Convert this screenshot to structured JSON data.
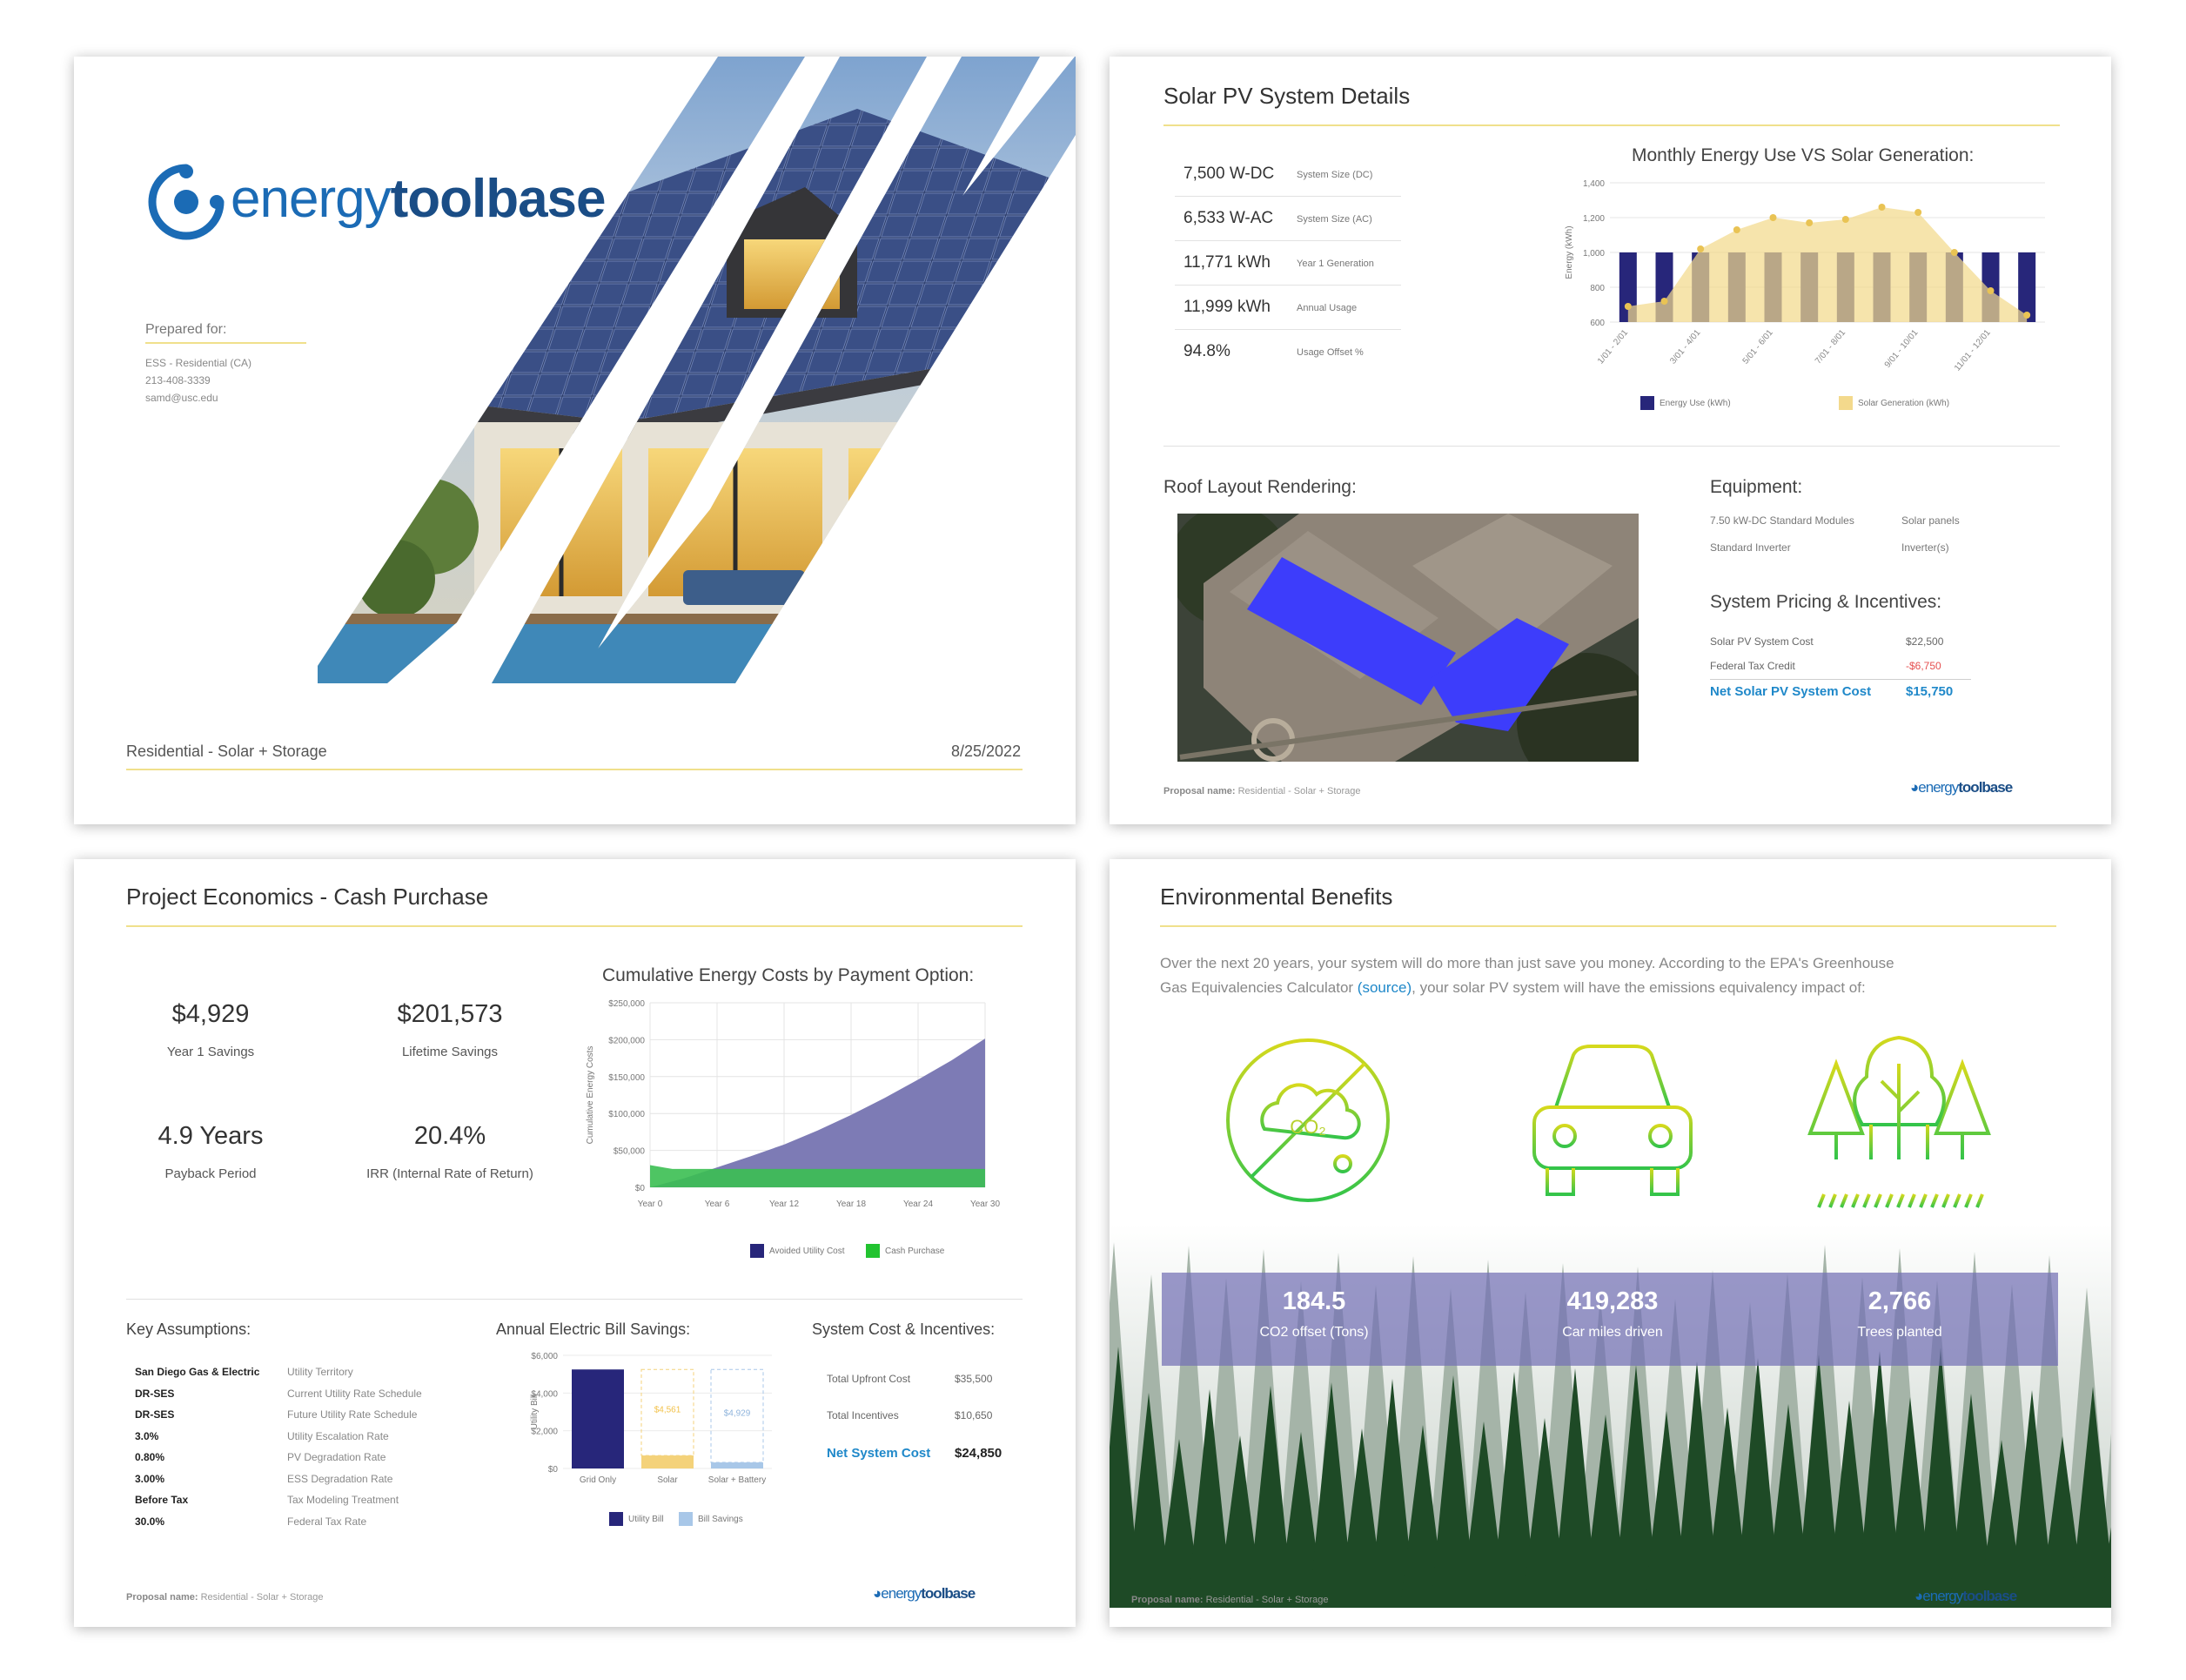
{
  "brand": {
    "name_part1": "energy",
    "name_part2": "toolbase",
    "colors": {
      "primary": "#1b6bb5",
      "accent_gold": "#f0e08c",
      "link_blue": "#1f88c9"
    }
  },
  "cover": {
    "prepared_for_label": "Prepared for:",
    "client_lines": [
      "ESS - Residential (CA)",
      "213-408-3339",
      "samd@usc.edu"
    ],
    "footer_left": "Residential - Solar + Storage",
    "footer_right": "8/25/2022"
  },
  "solar_details": {
    "title": "Solar PV System Details",
    "specs": [
      {
        "value": "7,500 W-DC",
        "label": "System Size (DC)"
      },
      {
        "value": "6,533 W-AC",
        "label": "System Size (AC)"
      },
      {
        "value": "11,771 kWh",
        "label": "Year 1 Generation"
      },
      {
        "value": "11,999 kWh",
        "label": "Annual Usage"
      },
      {
        "value": "94.8%",
        "label": "Usage Offset %"
      }
    ],
    "roof_title": "Roof Layout Rendering:",
    "equipment_title": "Equipment:",
    "equipment": [
      {
        "name": "7.50 kW-DC Standard Modules",
        "type": "Solar panels"
      },
      {
        "name": "Standard Inverter",
        "type": "Inverter(s)"
      }
    ],
    "pricing_title": "System Pricing & Incentives:",
    "pricing": [
      {
        "label": "Solar PV System Cost",
        "value": "$22,500"
      },
      {
        "label": "Federal Tax Credit",
        "value": "-$6,750"
      }
    ],
    "net_label": "Net Solar PV System Cost",
    "net_value": "$15,750",
    "footer_label": "Proposal name:",
    "footer_value": "Residential - Solar + Storage"
  },
  "economics": {
    "title": "Project Economics - Cash Purchase",
    "stats": [
      {
        "value": "$4,929",
        "label": "Year 1 Savings"
      },
      {
        "value": "$201,573",
        "label": "Lifetime Savings"
      },
      {
        "value": "4.9 Years",
        "label": "Payback Period"
      },
      {
        "value": "20.4%",
        "label": "IRR (Internal Rate of Return)"
      }
    ],
    "assumptions_title": "Key Assumptions:",
    "assumptions": [
      {
        "value": "San Diego Gas & Electric",
        "label": "Utility Territory"
      },
      {
        "value": "DR-SES",
        "label": "Current Utility Rate Schedule"
      },
      {
        "value": "DR-SES",
        "label": "Future Utility Rate Schedule"
      },
      {
        "value": "3.0%",
        "label": "Utility Escalation Rate"
      },
      {
        "value": "0.80%",
        "label": "PV Degradation Rate"
      },
      {
        "value": "3.00%",
        "label": "ESS Degradation Rate"
      },
      {
        "value": "Before Tax",
        "label": "Tax Modeling Treatment"
      },
      {
        "value": "30.0%",
        "label": "Federal Tax Rate"
      }
    ],
    "cost_title": "System Cost & Incentives:",
    "costs": [
      {
        "label": "Total Upfront Cost",
        "value": "$35,500"
      },
      {
        "label": "Total Incentives",
        "value": "$10,650"
      }
    ],
    "net_label": "Net System Cost",
    "net_value": "$24,850",
    "footer_label": "Proposal name:",
    "footer_value": "Residential - Solar + Storage"
  },
  "environment": {
    "title": "Environmental Benefits",
    "intro_1": "Over the next 20 years, your system will do more than just save you money.  According to the EPA's Greenhouse",
    "intro_2a": "Gas Equivalencies Calculator ",
    "intro_link": "(source)",
    "intro_2b": ", your solar PV system will have the emissions equivalency impact of:",
    "co2_glyph": "CO₂",
    "metrics": [
      {
        "value": "184.5",
        "label": "CO2 offset (Tons)"
      },
      {
        "value": "419,283",
        "label": "Car miles driven"
      },
      {
        "value": "2,766",
        "label": "Trees planted"
      }
    ],
    "icons": [
      "co2-cloud-icon",
      "car-icon",
      "trees-icon"
    ],
    "footer_label": "Proposal name:",
    "footer_value": "Residential - Solar + Storage"
  },
  "chart_data": [
    {
      "type": "bar",
      "title": "Monthly Energy Use VS Solar Generation:",
      "ylabel": "Energy (kWh)",
      "ylim": [
        600,
        1400
      ],
      "yticks": [
        "600",
        "800",
        "1,000",
        "1,200",
        "1,400"
      ],
      "categories": [
        "1/01 - 2/01",
        "2/01 - 3/01",
        "3/01 - 4/01",
        "4/01 - 5/01",
        "5/01 - 6/01",
        "6/01 - 7/01",
        "7/01 - 8/01",
        "8/01 - 9/01",
        "9/01 - 10/01",
        "10/01 - 11/01",
        "11/01 - 12/01",
        "12/01 - 1/01"
      ],
      "xtick_labels": [
        "1/01 - 2/01",
        "3/01 - 4/01",
        "5/01 - 6/01",
        "7/01 - 8/01",
        "9/01 - 10/01",
        "11/01 - 12/01"
      ],
      "series": [
        {
          "name": "Energy Use (kWh)",
          "type": "bar",
          "color": "#27267a",
          "values": [
            1000,
            1000,
            1000,
            1000,
            1000,
            1000,
            1000,
            1000,
            1000,
            1000,
            1000,
            1000
          ]
        },
        {
          "name": "Solar Generation (kWh)",
          "type": "area",
          "color": "#f3d98c",
          "values": [
            690,
            720,
            1020,
            1130,
            1200,
            1170,
            1190,
            1260,
            1230,
            1000,
            780,
            640
          ]
        }
      ]
    },
    {
      "type": "area",
      "title": "Cumulative Energy Costs by Payment Option:",
      "ylabel": "Cumulative Energy Costs",
      "ylim": [
        0,
        250000
      ],
      "yticks": [
        "$0",
        "$50,000",
        "$100,000",
        "$150,000",
        "$200,000",
        "$250,000"
      ],
      "xlim": [
        0,
        30
      ],
      "xticks": [
        "Year 0",
        "Year 6",
        "Year 12",
        "Year 18",
        "Year 24",
        "Year 30"
      ],
      "series": [
        {
          "name": "Avoided Utility Cost",
          "color": "#7d7bb5",
          "x": [
            0,
            3,
            6,
            9,
            12,
            15,
            18,
            21,
            24,
            27,
            30
          ],
          "values": [
            0,
            12000,
            27000,
            42000,
            58000,
            77000,
            98000,
            121000,
            146000,
            172000,
            201573
          ]
        },
        {
          "name": "Cash Purchase",
          "color": "#3bbf52",
          "x": [
            0,
            2,
            3,
            30
          ],
          "values": [
            30000,
            24850,
            24850,
            24850
          ]
        }
      ]
    },
    {
      "type": "bar",
      "title": "Annual Electric Bill Savings:",
      "ylabel": "Utility Bill",
      "ylim": [
        0,
        6000
      ],
      "yticks": [
        "$0",
        "$2,000",
        "$4,000",
        "$6,000"
      ],
      "categories": [
        "Grid Only",
        "Solar",
        "Solar + Battery"
      ],
      "series": [
        {
          "name": "Utility Bill",
          "color": "#27267a",
          "values": [
            5250,
            689,
            321
          ]
        },
        {
          "name": "Bill Savings",
          "color": "#a8c7e8",
          "values": [
            0,
            4561,
            4929
          ]
        }
      ],
      "data_labels": [
        "",
        "$4,561",
        "$4,929"
      ]
    }
  ]
}
